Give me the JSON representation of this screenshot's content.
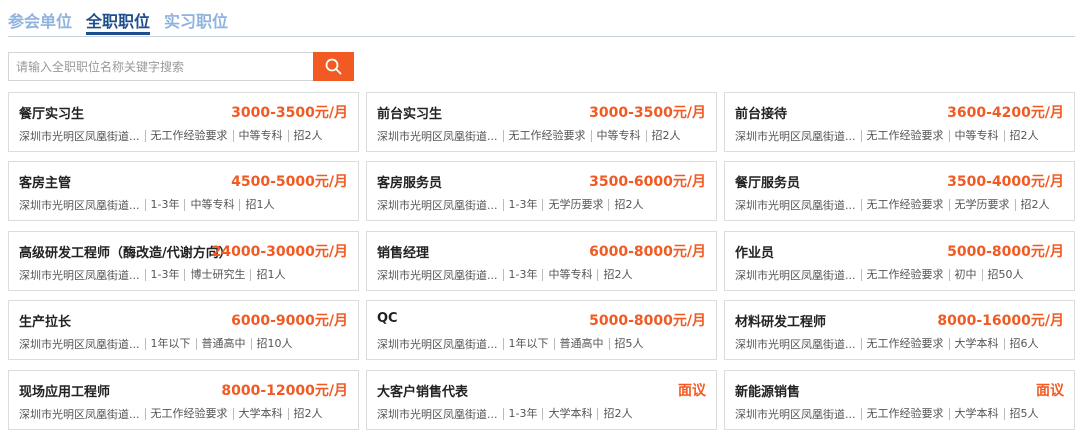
{
  "tabs": [
    "参会单位",
    "全职职位",
    "实习职位"
  ],
  "active_tab": "全职职位",
  "search": {
    "placeholder": "请输入全职职位名称关键字搜索"
  },
  "colors": {
    "accent": "#f15a22",
    "tab_active": "#1e4e8c",
    "tab_inactive": "#8fb3de"
  },
  "jobs": [
    {
      "title": "餐厅实习生",
      "salary": "3000-3500元/月",
      "location": "深圳市光明区凤凰街道...",
      "experience": "无工作经验要求",
      "education": "中等专科",
      "headcount": "招2人"
    },
    {
      "title": "前台实习生",
      "salary": "3000-3500元/月",
      "location": "深圳市光明区凤凰街道...",
      "experience": "无工作经验要求",
      "education": "中等专科",
      "headcount": "招2人"
    },
    {
      "title": "前台接待",
      "salary": "3600-4200元/月",
      "location": "深圳市光明区凤凰街道...",
      "experience": "无工作经验要求",
      "education": "中等专科",
      "headcount": "招2人"
    },
    {
      "title": "客房主管",
      "salary": "4500-5000元/月",
      "location": "深圳市光明区凤凰街道...",
      "experience": "1-3年",
      "education": "中等专科",
      "headcount": "招1人"
    },
    {
      "title": "客房服务员",
      "salary": "3500-6000元/月",
      "location": "深圳市光明区凤凰街道...",
      "experience": "1-3年",
      "education": "无学历要求",
      "headcount": "招2人"
    },
    {
      "title": "餐厅服务员",
      "salary": "3500-4000元/月",
      "location": "深圳市光明区凤凰街道...",
      "experience": "无工作经验要求",
      "education": "无学历要求",
      "headcount": "招2人"
    },
    {
      "title": "高级研发工程师（酶改造/代谢方向）",
      "salary": "24000-30000元/月",
      "location": "深圳市光明区凤凰街道...",
      "experience": "1-3年",
      "education": "博士研究生",
      "headcount": "招1人"
    },
    {
      "title": "销售经理",
      "salary": "6000-8000元/月",
      "location": "深圳市光明区凤凰街道...",
      "experience": "1-3年",
      "education": "中等专科",
      "headcount": "招2人"
    },
    {
      "title": "作业员",
      "salary": "5000-8000元/月",
      "location": "深圳市光明区凤凰街道...",
      "experience": "无工作经验要求",
      "education": "初中",
      "headcount": "招50人"
    },
    {
      "title": "生产拉长",
      "salary": "6000-9000元/月",
      "location": "深圳市光明区凤凰街道...",
      "experience": "1年以下",
      "education": "普通高中",
      "headcount": "招10人"
    },
    {
      "title": "QC",
      "salary": "5000-8000元/月",
      "location": "深圳市光明区凤凰街道...",
      "experience": "1年以下",
      "education": "普通高中",
      "headcount": "招5人"
    },
    {
      "title": "材料研发工程师",
      "salary": "8000-16000元/月",
      "location": "深圳市光明区凤凰街道...",
      "experience": "无工作经验要求",
      "education": "大学本科",
      "headcount": "招6人"
    },
    {
      "title": "现场应用工程师",
      "salary": "8000-12000元/月",
      "location": "深圳市光明区凤凰街道...",
      "experience": "无工作经验要求",
      "education": "大学本科",
      "headcount": "招2人"
    },
    {
      "title": "大客户销售代表",
      "salary": "面议",
      "location": "深圳市光明区凤凰街道...",
      "experience": "1-3年",
      "education": "大学本科",
      "headcount": "招2人"
    },
    {
      "title": "新能源销售",
      "salary": "面议",
      "location": "深圳市光明区凤凰街道...",
      "experience": "无工作经验要求",
      "education": "大学本科",
      "headcount": "招5人"
    }
  ]
}
